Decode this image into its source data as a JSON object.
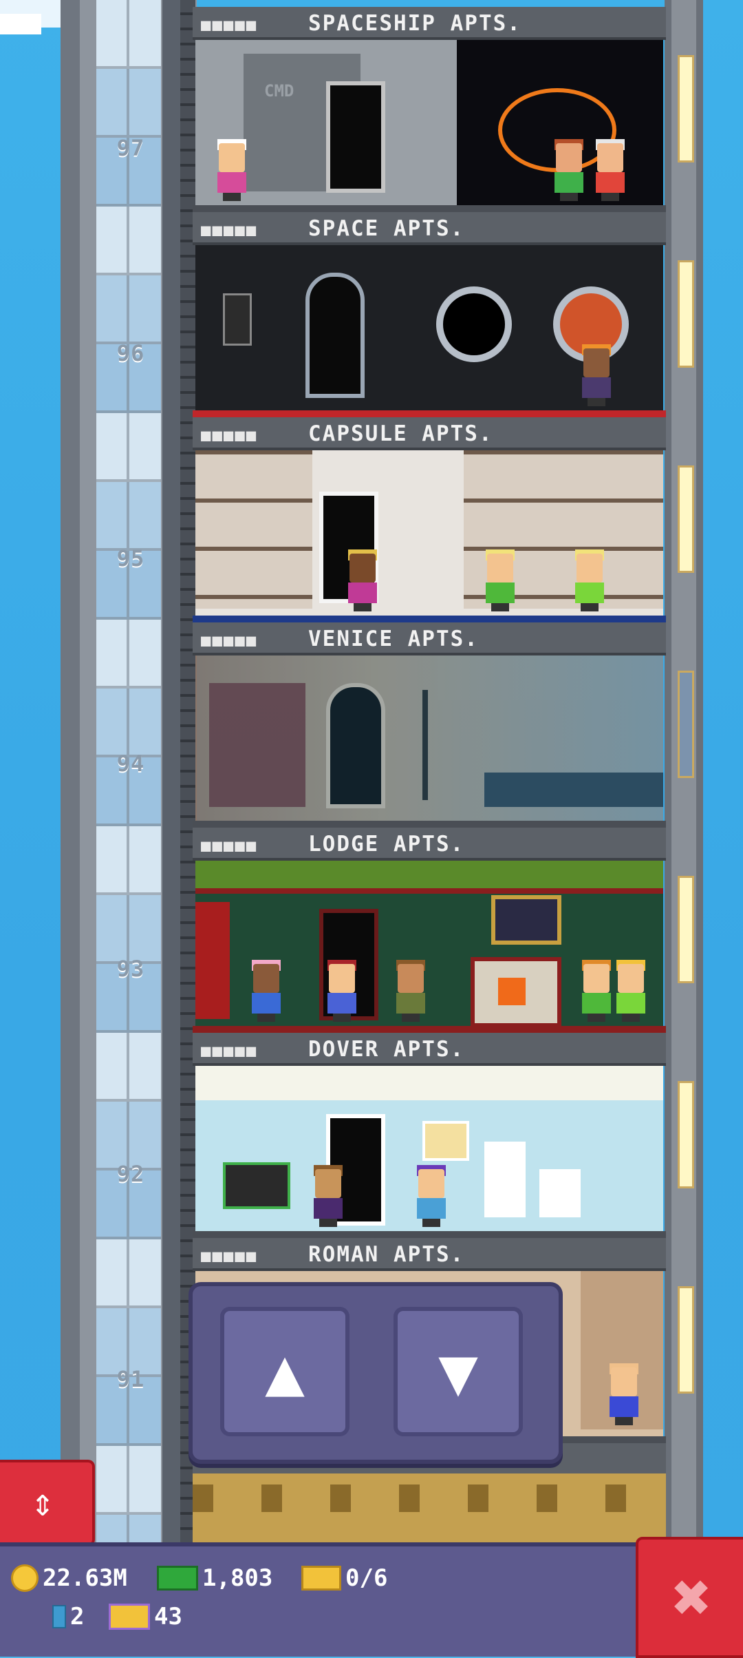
{
  "floors": [
    {
      "number": "97",
      "name": "SPACESHIP APTS.",
      "dots": "■■■■■"
    },
    {
      "number": "96",
      "name": "SPACE APTS.",
      "dots": "■■■■■"
    },
    {
      "number": "95",
      "name": "CAPSULE APTS.",
      "dots": "■■■■■"
    },
    {
      "number": "94",
      "name": "VENICE APTS.",
      "dots": "■■■■■"
    },
    {
      "number": "93",
      "name": "LODGE APTS.",
      "dots": "■■■■■"
    },
    {
      "number": "92",
      "name": "DOVER APTS.",
      "dots": "■■■■■"
    },
    {
      "number": "91",
      "name": "ROMAN APTS.",
      "dots": "■■■■■"
    }
  ],
  "labels": {
    "cmd": "CMD"
  },
  "controls": {
    "up_symbol": "▲",
    "down_symbol": "▼",
    "toggle_symbol": "⇕",
    "close_symbol": "✖"
  },
  "stats": {
    "coins": "22.63M",
    "bux": "1,803",
    "tickets": "0/6",
    "keys": "2",
    "vip": "43"
  },
  "colors": {
    "sky": "#3fb1ea",
    "panel": "#5a5888",
    "bar": "#5d5a8e",
    "red": "#dc2d3a"
  }
}
